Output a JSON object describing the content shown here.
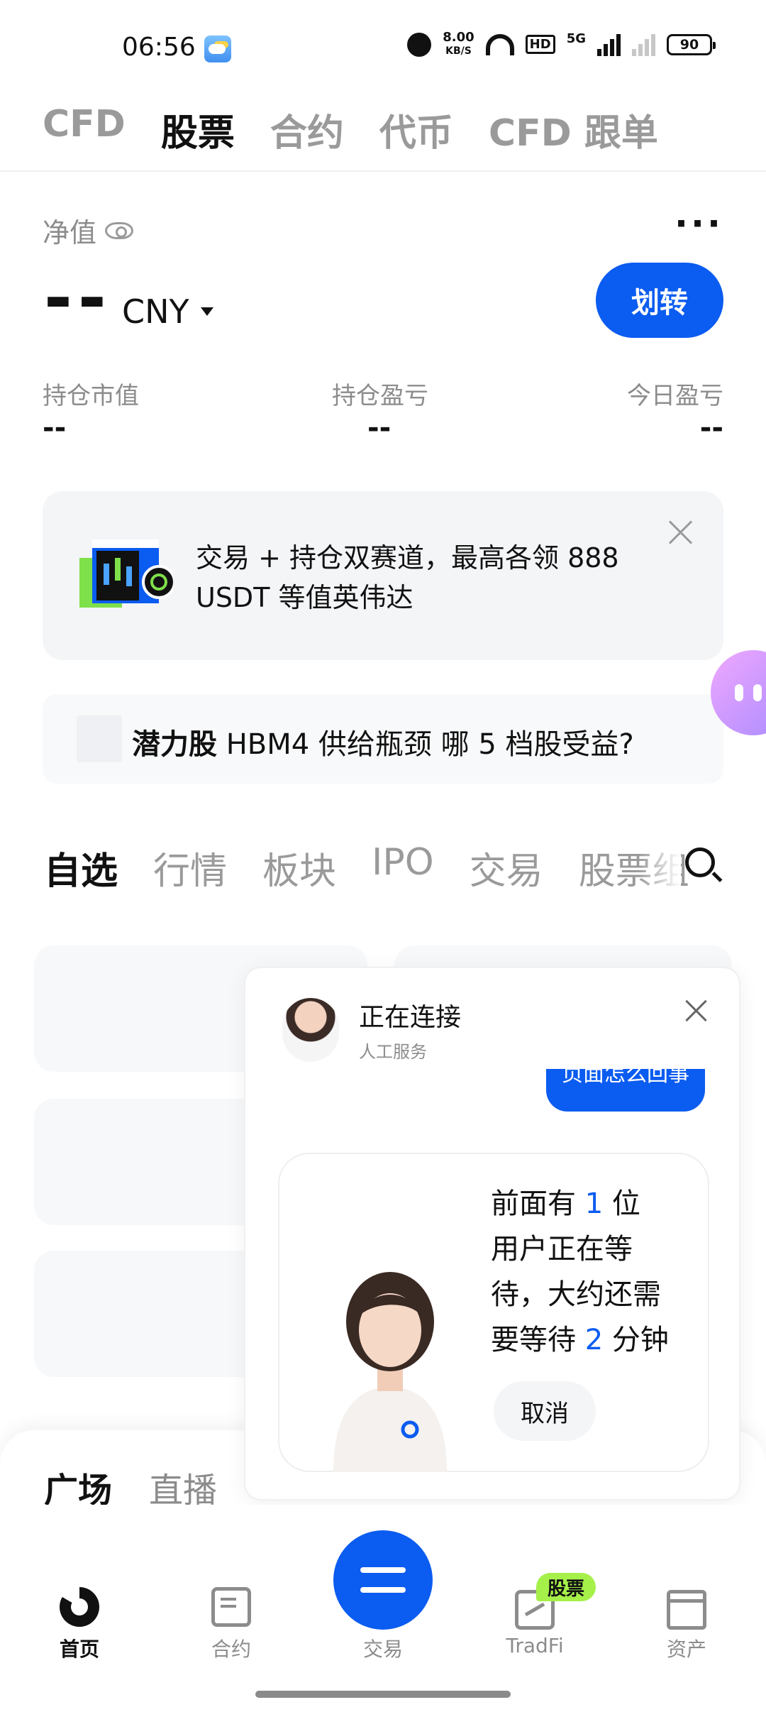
{
  "status_bar": {
    "time": "06:56",
    "net_speed_value": "8.00",
    "net_speed_unit": "KB/S",
    "hd_label": "HD",
    "network": "5G",
    "battery": "90"
  },
  "top_tabs": [
    {
      "label": "CFD",
      "active": false
    },
    {
      "label": "股票",
      "active": true
    },
    {
      "label": "合约",
      "active": false
    },
    {
      "label": "代币",
      "active": false
    },
    {
      "label": "CFD 跟单",
      "active": false
    }
  ],
  "account": {
    "net_value_label": "净值",
    "net_value": "--",
    "currency": "CNY",
    "transfer_button": "划转",
    "more_label": "···",
    "stats": [
      {
        "label": "持仓市值",
        "value": "--"
      },
      {
        "label": "持仓盈亏",
        "value": "--"
      },
      {
        "label": "今日盈亏",
        "value": "--"
      }
    ]
  },
  "promo": {
    "text": "交易 + 持仓双赛道，最高各领 888 USDT 等值英伟达"
  },
  "news": {
    "highlight": "潜力股",
    "text": " HBM4 供给瓶颈 哪 5 档股受益?"
  },
  "sub_tabs": [
    {
      "label": "自选",
      "active": true
    },
    {
      "label": "行情",
      "active": false
    },
    {
      "label": "板块",
      "active": false
    },
    {
      "label": "IPO",
      "active": false
    },
    {
      "label": "交易",
      "active": false
    },
    {
      "label": "股票组",
      "active": false
    }
  ],
  "sheet_tabs": [
    {
      "label": "广场",
      "active": true
    },
    {
      "label": "直播",
      "active": false
    }
  ],
  "chat_popup": {
    "title": "正在连接",
    "subtitle": "人工服务",
    "user_message": "页面怎么回事",
    "queue_line1_a": "前面有 ",
    "queue_count": "1",
    "queue_line1_b": " 位",
    "queue_line2": "用户正在等",
    "queue_line3": "待，大约还需",
    "queue_line4_a": "要等待 ",
    "queue_minutes": "2",
    "queue_line4_b": " 分钟",
    "cancel_button": "取消"
  },
  "bottom_nav": [
    {
      "label": "首页",
      "icon": "home-icon",
      "active": true
    },
    {
      "label": "合约",
      "icon": "contract-icon",
      "active": false
    },
    {
      "label": "交易",
      "icon": "swap-icon",
      "active": false
    },
    {
      "label": "TradFi",
      "icon": "tradfi-icon",
      "active": false,
      "badge": "股票"
    },
    {
      "label": "资产",
      "icon": "wallet-icon",
      "active": false
    }
  ],
  "colors": {
    "accent": "#0b5cf0",
    "badge": "#a6f04a",
    "muted": "#8c8c8c"
  }
}
